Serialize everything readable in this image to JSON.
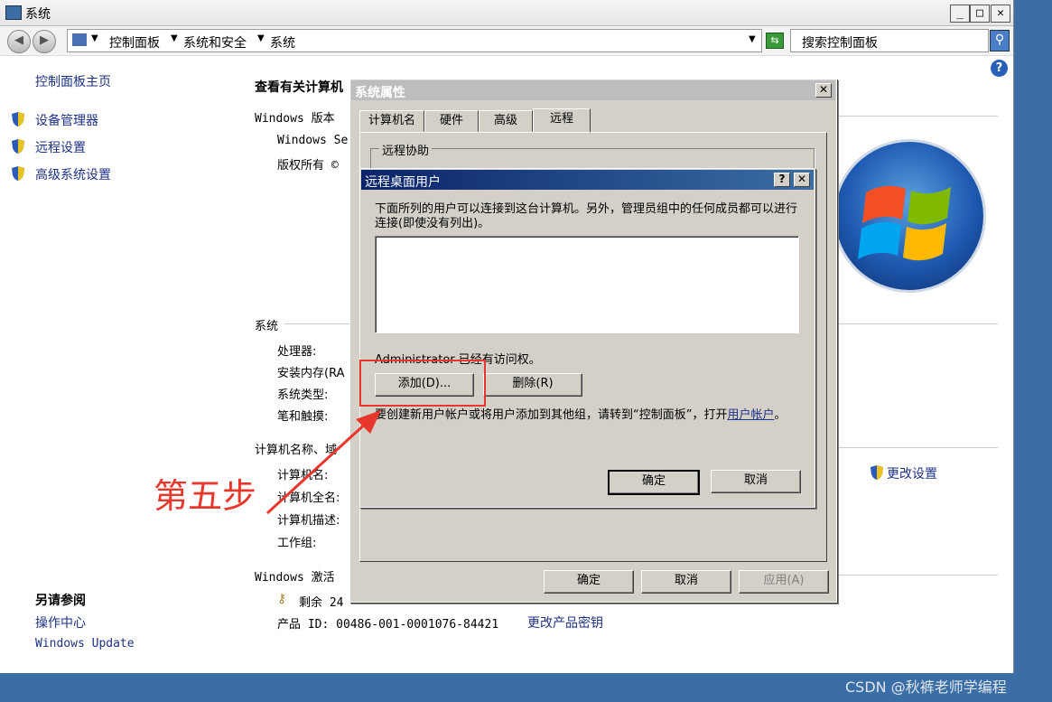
{
  "window": {
    "title": "系统"
  },
  "address": {
    "crumbs": [
      "控制面板",
      "系统和安全",
      "系统"
    ],
    "search_placeholder": "搜索控制面板"
  },
  "sidebar": {
    "home": "控制面板主页",
    "items": [
      {
        "label": "设备管理器",
        "icon": "shield-icon"
      },
      {
        "label": "远程设置",
        "icon": "shield-icon"
      },
      {
        "label": "高级系统设置",
        "icon": "shield-icon"
      }
    ],
    "see_also_title": "另请参阅",
    "see_also": [
      "操作中心",
      "Windows Update"
    ]
  },
  "main": {
    "heading": "查看有关计算机",
    "win_edition_label": "Windows 版本",
    "win_edition_value": "Windows Se",
    "copyright": "版权所有 ©",
    "system_label": "系统",
    "processor": "处理器:",
    "ram": "安装内存(RA",
    "sys_type": "系统类型:",
    "pen_touch": "笔和触摸:",
    "computer_section": "计算机名称、域",
    "comp_name": "计算机名:",
    "comp_full": "计算机全名:",
    "comp_desc": "计算机描述:",
    "workgroup": "工作组:",
    "change_settings": "更改设置",
    "activation_label": "Windows 激活",
    "remaining": "剩余 24",
    "product_id": "产品 ID: 00486-001-0001076-84421",
    "change_key": "更改产品密钥"
  },
  "sysprops": {
    "title": "系统属性",
    "tabs": [
      "计算机名",
      "硬件",
      "高级",
      "远程"
    ],
    "group": "远程协助",
    "ok": "确定",
    "cancel": "取消",
    "apply": "应用(A)"
  },
  "rdp": {
    "title": "远程桌面用户",
    "desc": "下面所列的用户可以连接到这台计算机。另外，管理员组中的任何成员都可以进行连接(即使没有列出)。",
    "admin_note": "Administrator 已经有访问权。",
    "add": "添加(D)...",
    "remove": "删除(R)",
    "note": "要创建新用户帐户或将用户添加到其他组，请转到“控制面板”，打开",
    "note_link": "用户帐户",
    "note_end": "。",
    "ok": "确定",
    "cancel": "取消"
  },
  "annotation": {
    "step": "第五步"
  },
  "watermark": "CSDN @秋裤老师学编程",
  "colors": {
    "link": "#1e3287",
    "annotation_red": "#e8372c",
    "desktop": "#3a6ea5"
  }
}
